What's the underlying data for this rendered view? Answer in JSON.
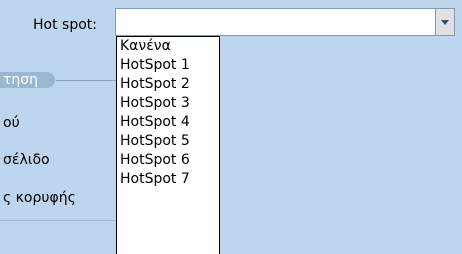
{
  "field": {
    "label": "Hot spot:",
    "value": ""
  },
  "sidebar": {
    "group_label": "τηση",
    "items": [
      {
        "label": "ού"
      },
      {
        "label": "σέλιδο"
      },
      {
        "label": "ς κορυφής"
      }
    ]
  },
  "dropdown": {
    "options": [
      {
        "label": "Κανένα"
      },
      {
        "label": "HotSpot 1"
      },
      {
        "label": "HotSpot 2"
      },
      {
        "label": "HotSpot 3"
      },
      {
        "label": "HotSpot 4"
      },
      {
        "label": "HotSpot 5"
      },
      {
        "label": "HotSpot 6"
      },
      {
        "label": "HotSpot 7"
      }
    ]
  },
  "icons": {
    "combo_arrow": "chevron-down-icon"
  },
  "colors": {
    "panel_bg": "#bdd6ee",
    "list_bg": "#ffffff",
    "group_header": "#9bb6d0"
  }
}
